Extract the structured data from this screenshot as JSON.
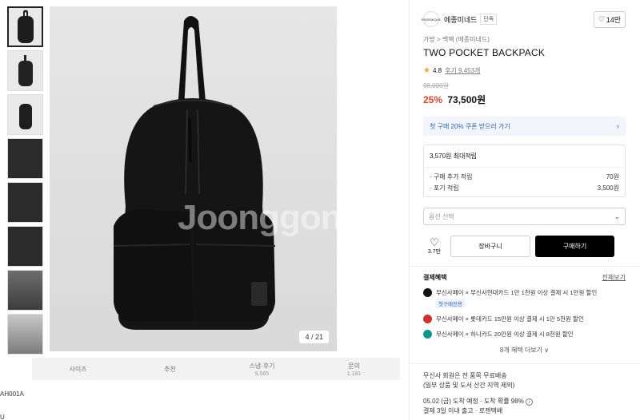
{
  "gallery": {
    "counter": "4 / 21",
    "watermark": "Joonggonara",
    "thumbs": [
      "thumb-1",
      "thumb-2",
      "thumb-3",
      "thumb-4",
      "thumb-5",
      "thumb-6",
      "thumb-7",
      "thumb-8"
    ]
  },
  "tabs": [
    {
      "label": "사이즈",
      "count": ""
    },
    {
      "label": "추천",
      "count": ""
    },
    {
      "label": "스냅·후기",
      "count": "9,565"
    },
    {
      "label": "문의",
      "count": "1,181"
    }
  ],
  "sku": "AH001A",
  "sku2": "U",
  "brand": {
    "logo": "ENDEMIQUE",
    "name": "에종미네드",
    "tag": "단독",
    "likes": "14만"
  },
  "breadcrumb": "가방 > 백팩 (에종미네드)",
  "title": "TWO POCKET BACKPACK",
  "rating": {
    "score": "4.8",
    "reviews": "후기 9,453개"
  },
  "price": {
    "original": "98,000원",
    "discount": "25%",
    "final": "73,500원"
  },
  "coupon": "첫 구매 20% 쿠폰 받으러 가기",
  "points": {
    "header": "3,570원 최대적립",
    "rows": [
      {
        "label": "· 구매 추가 적립",
        "value": "70원"
      },
      {
        "label": "· 포기 적립",
        "value": "3,500원"
      }
    ]
  },
  "option_placeholder": "옵션 선택",
  "actions": {
    "like_count": "3.7만",
    "cart": "장바구니",
    "buy": "구매하기"
  },
  "benefits": {
    "title": "결제혜택",
    "more": "전체보기",
    "items": [
      {
        "text": "무신사페이 × 무신사현대카드 1만 1천원 이상 결제 시 1만원 할인",
        "tag": "첫구매전용",
        "color": "#111111"
      },
      {
        "text": "무신사페이 × 롯데카드 15만원 이상 결제 시 1만 5천원 할인",
        "tag": "",
        "color": "#d42e2e"
      },
      {
        "text": "무신사페이 × 하나카드 20만원 이상 결제 시 8천원 할인",
        "tag": "",
        "color": "#0a9a8a"
      }
    ],
    "expand": "8개 혜택 더보기 ∨"
  },
  "shipping": {
    "line1": "무신사 회원은 전 품목 무료배송",
    "line2": "(일부 상품 및 도서 산간 지역 제외)",
    "line3": "05.02 (금) 도착 예정 · 도착 확률 98%",
    "line4": "결제 3일 이내 출고 · 로젠택배"
  }
}
